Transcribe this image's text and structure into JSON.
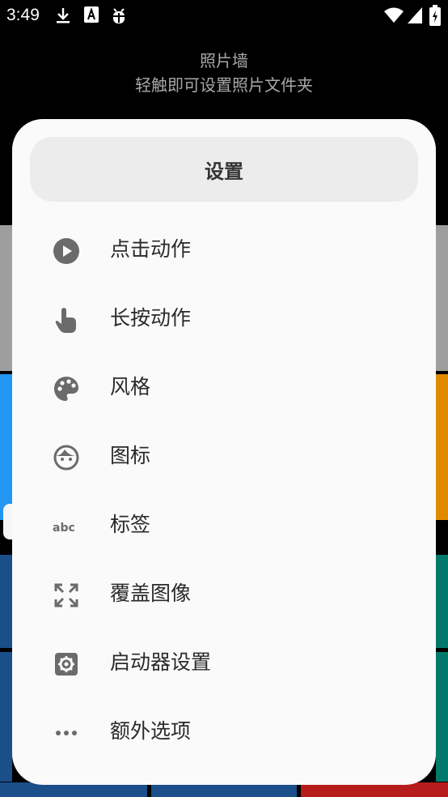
{
  "status_bar": {
    "time": "3:49"
  },
  "header": {
    "title": "照片墙",
    "subtitle": "轻触即可设置照片文件夹"
  },
  "dialog": {
    "title": "设置",
    "items": [
      {
        "label": "点击动作",
        "icon": "play-circle-icon"
      },
      {
        "label": "长按动作",
        "icon": "touch-hand-icon"
      },
      {
        "label": "风格",
        "icon": "palette-icon"
      },
      {
        "label": "图标",
        "icon": "face-icon"
      },
      {
        "label": "标签",
        "icon": "abc-text-icon"
      },
      {
        "label": "覆盖图像",
        "icon": "expand-arrows-icon"
      },
      {
        "label": "启动器设置",
        "icon": "settings-gear-icon"
      },
      {
        "label": "额外选项",
        "icon": "more-dots-icon"
      }
    ]
  },
  "colors": {
    "dialog_bg": "#fafafa",
    "title_bg": "#ececec",
    "icon_gray": "#6b6b6b",
    "tile_blue": "#2196f3",
    "tile_orange": "#e08a00",
    "tile_teal": "#00796b",
    "tile_navy": "#1a4f8a",
    "tile_red": "#b71c1c"
  }
}
